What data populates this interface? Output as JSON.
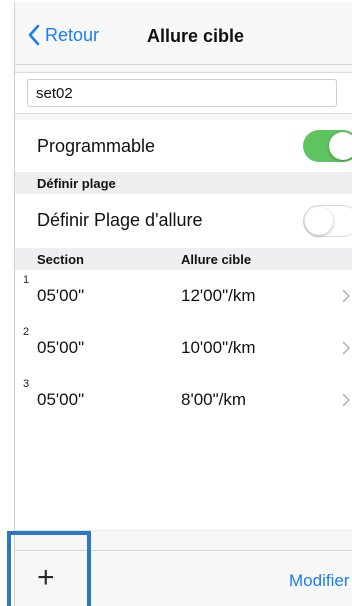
{
  "navbar": {
    "back_label": "Retour",
    "title": "Allure cible"
  },
  "name_field": {
    "value": "set02"
  },
  "programmable": {
    "label": "Programmable",
    "on": true
  },
  "range_section": {
    "header": "Définir plage"
  },
  "range_toggle": {
    "label": "Définir Plage d'allure",
    "on": false
  },
  "table": {
    "columns": [
      "Section",
      "Allure cible"
    ],
    "rows": [
      {
        "index": "1",
        "section": "05'00\"",
        "pace": "12'00\"/km"
      },
      {
        "index": "2",
        "section": "05'00\"",
        "pace": "10'00\"/km"
      },
      {
        "index": "3",
        "section": "05'00\"",
        "pace": "8'00\"/km"
      }
    ]
  },
  "toolbar": {
    "add_symbol": "+",
    "modify_label": "Modifier"
  },
  "colors": {
    "accent": "#1a7ef2",
    "toggle_on": "#5ec45f",
    "highlight": "#2c77c4"
  },
  "icons": [
    "chevron-left-icon",
    "chevron-right-icon",
    "plus-icon"
  ]
}
